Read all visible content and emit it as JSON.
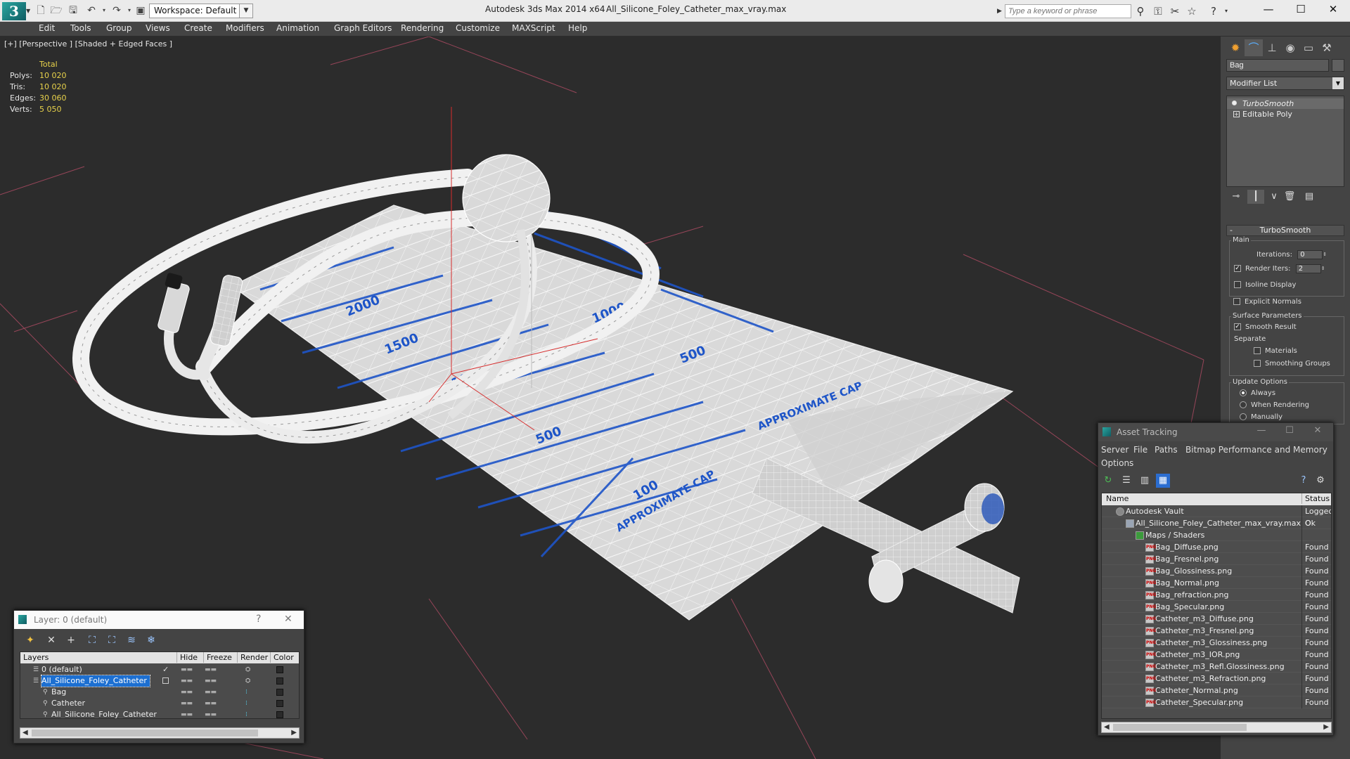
{
  "titlebar": {
    "app_title": "Autodesk 3ds Max  2014 x64",
    "file_name": "All_Silicone_Foley_Catheter_max_vray.max",
    "workspace": "Workspace: Default",
    "search_placeholder": "Type a keyword or phrase"
  },
  "menu": [
    "Edit",
    "Tools",
    "Group",
    "Views",
    "Create",
    "Modifiers",
    "Animation",
    "Graph Editors",
    "Rendering",
    "Customize",
    "MAXScript",
    "Help"
  ],
  "viewport": {
    "label": "[+] [Perspective ] [Shaded + Edged Faces ]",
    "stats_header": "Total",
    "stats": [
      {
        "label": "Polys:",
        "value": "10 020"
      },
      {
        "label": "Tris:",
        "value": "10 020"
      },
      {
        "label": "Edges:",
        "value": "30 060"
      },
      {
        "label": "Verts:",
        "value": "5 050"
      }
    ],
    "bag_texts": [
      "2000",
      "1500",
      "1000",
      "1000",
      "500",
      "500",
      "100",
      "APPROXIMATE CAP",
      "APPROXIMATE CAP"
    ]
  },
  "command_panel": {
    "object_name": "Bag",
    "modifier_list": "Modifier List",
    "stack": [
      "TurboSmooth",
      "Editable Poly"
    ],
    "rollout_title": "TurboSmooth",
    "main_label": "Main",
    "iterations_label": "Iterations:",
    "iterations_value": "0",
    "render_iters_label": "Render Iters:",
    "render_iters_value": "2",
    "isoline_display": "Isoline Display",
    "explicit_normals": "Explicit Normals",
    "surface_params": "Surface Parameters",
    "smooth_result": "Smooth Result",
    "separate": "Separate",
    "materials": "Materials",
    "smoothing_groups": "Smoothing Groups",
    "update_options": "Update Options",
    "always": "Always",
    "when_rendering": "When Rendering",
    "manually": "Manually"
  },
  "asset_tracking": {
    "title": "Asset Tracking",
    "menu": [
      "Server",
      "File",
      "Paths",
      "Bitmap Performance and Memory",
      "Options"
    ],
    "columns": {
      "name": "Name",
      "status": "Status"
    },
    "rows": [
      {
        "name": "Autodesk Vault",
        "status": "Logged O",
        "level": 0,
        "kind": "vault"
      },
      {
        "name": "All_Silicone_Foley_Catheter_max_vray.max",
        "status": "Ok",
        "level": 1,
        "kind": "max"
      },
      {
        "name": "Maps / Shaders",
        "status": "",
        "level": 2,
        "kind": "maps"
      },
      {
        "name": "Bag_Diffuse.png",
        "status": "Found",
        "level": 3,
        "kind": "png"
      },
      {
        "name": "Bag_Fresnel.png",
        "status": "Found",
        "level": 3,
        "kind": "png"
      },
      {
        "name": "Bag_Glossiness.png",
        "status": "Found",
        "level": 3,
        "kind": "png"
      },
      {
        "name": "Bag_Normal.png",
        "status": "Found",
        "level": 3,
        "kind": "png"
      },
      {
        "name": "Bag_refraction.png",
        "status": "Found",
        "level": 3,
        "kind": "png"
      },
      {
        "name": "Bag_Specular.png",
        "status": "Found",
        "level": 3,
        "kind": "png"
      },
      {
        "name": "Catheter_m3_Diffuse.png",
        "status": "Found",
        "level": 3,
        "kind": "png"
      },
      {
        "name": "Catheter_m3_Fresnel.png",
        "status": "Found",
        "level": 3,
        "kind": "png"
      },
      {
        "name": "Catheter_m3_Glossiness.png",
        "status": "Found",
        "level": 3,
        "kind": "png"
      },
      {
        "name": "Catheter_m3_IOR.png",
        "status": "Found",
        "level": 3,
        "kind": "png"
      },
      {
        "name": "Catheter_m3_Refl.Glossiness.png",
        "status": "Found",
        "level": 3,
        "kind": "png"
      },
      {
        "name": "Catheter_m3_Refraction.png",
        "status": "Found",
        "level": 3,
        "kind": "png"
      },
      {
        "name": "Catheter_Normal.png",
        "status": "Found",
        "level": 3,
        "kind": "png"
      },
      {
        "name": "Catheter_Specular.png",
        "status": "Found",
        "level": 3,
        "kind": "png"
      }
    ]
  },
  "layer_dialog": {
    "title": "Layer: 0 (default)",
    "columns": {
      "layers": "Layers",
      "hide": "Hide",
      "freeze": "Freeze",
      "render": "Render",
      "color": "Color"
    },
    "rows": [
      {
        "name": "0 (default)",
        "level": 0,
        "selected": false,
        "active": true
      },
      {
        "name": "All_Silicone_Foley_Catheter",
        "level": 0,
        "selected": true,
        "active": false
      },
      {
        "name": "Bag",
        "level": 1,
        "selected": false,
        "active": false
      },
      {
        "name": "Catheter",
        "level": 1,
        "selected": false,
        "active": false
      },
      {
        "name": "All_Silicone_Foley_Catheter",
        "level": 1,
        "selected": false,
        "active": false
      }
    ]
  }
}
